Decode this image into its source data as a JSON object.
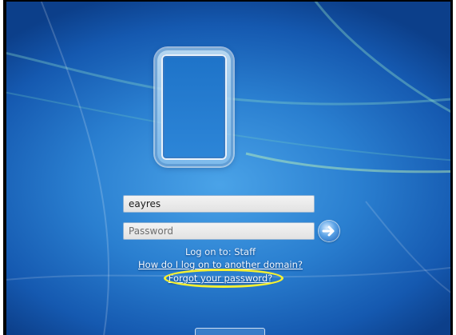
{
  "login": {
    "username_value": "eayres",
    "password_placeholder": "Password",
    "logon_to_text": "Log on to: Staff",
    "domain_link": "How do I log on to another domain?",
    "forgot_link": "Forgot your password?"
  },
  "icons": {
    "submit": "arrow-right-icon",
    "user_tile": "user-picture-icon"
  },
  "colors": {
    "background": "#2a7fd0",
    "highlight": "#f5f032",
    "text": "#eaf4ff"
  }
}
